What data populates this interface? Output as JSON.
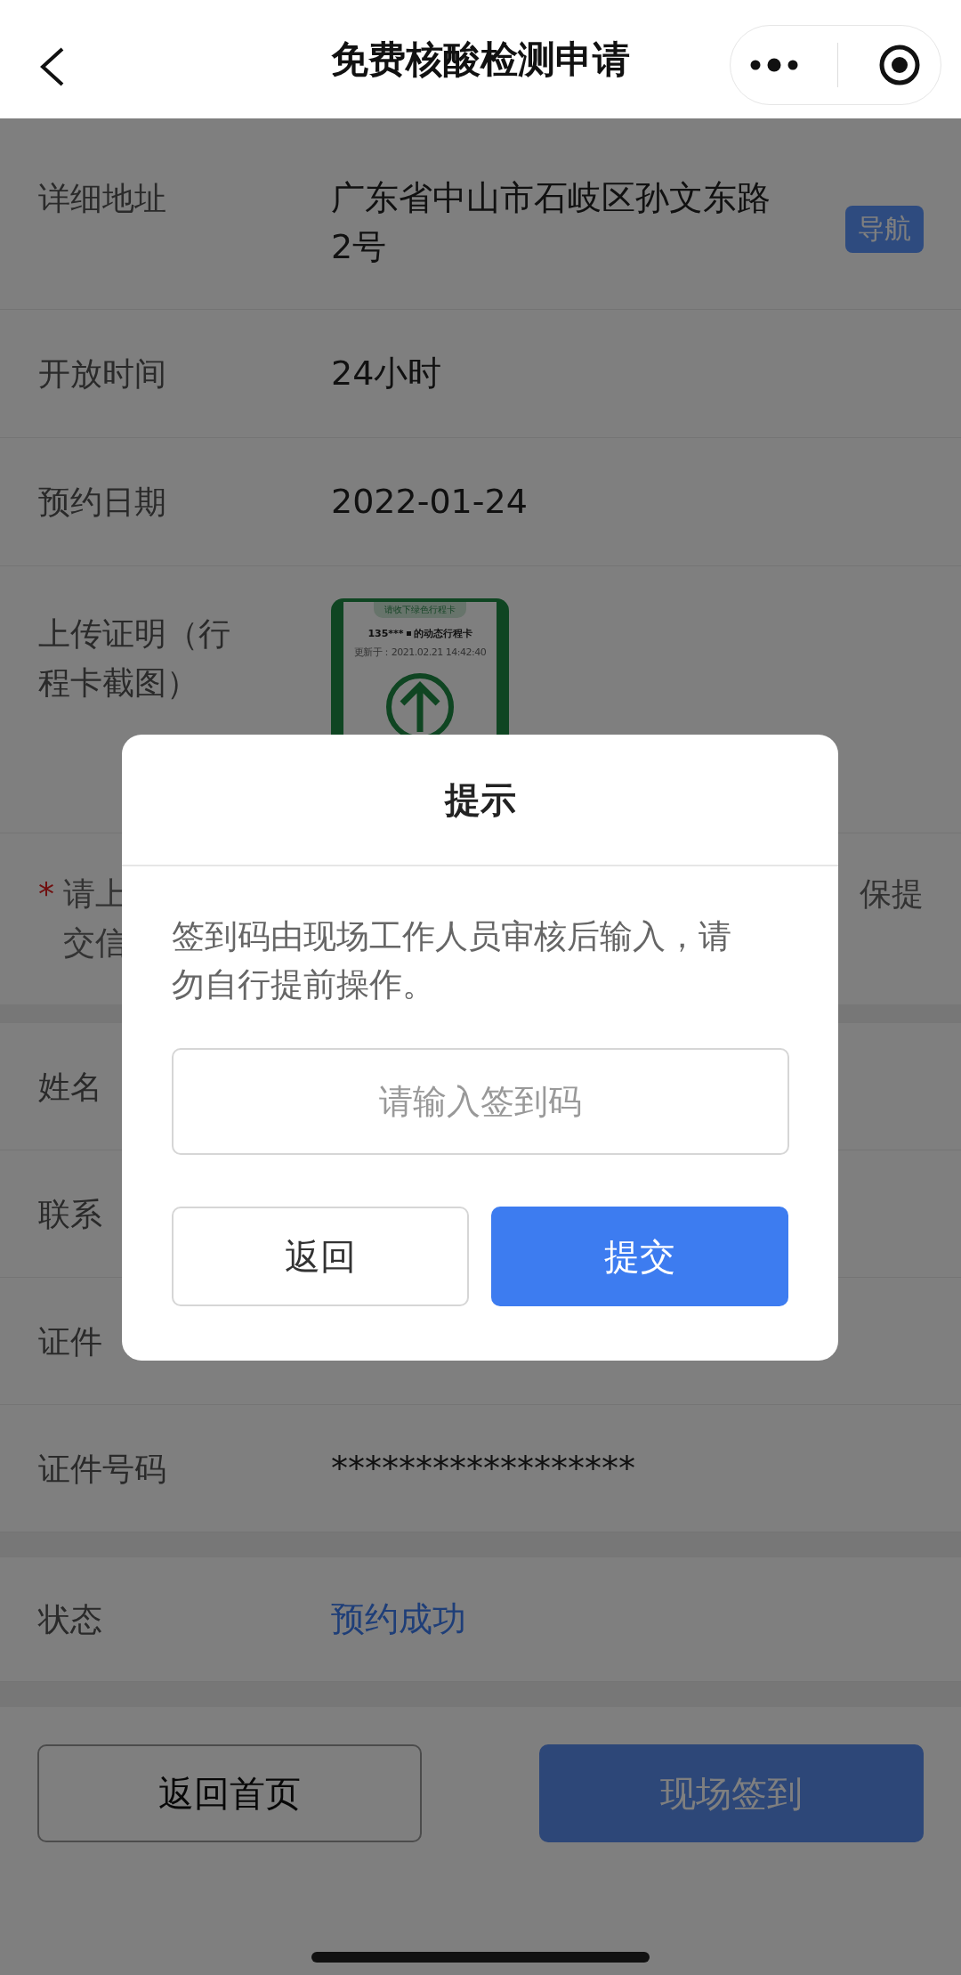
{
  "header": {
    "title": "免费核酸检测申请"
  },
  "details": [
    {
      "label": "详细地址",
      "value": "广东省中山市石岐区孙文东路2号",
      "action": "导航"
    },
    {
      "label": "开放时间",
      "value": "24小时"
    },
    {
      "label": "预约日期",
      "value": "2022-01-24"
    }
  ],
  "upload": {
    "label": "上传证明（行程卡截图）",
    "screenshot": {
      "banner": "请收下绿色行程卡",
      "phone": "135***",
      "heading": "的动态行程卡",
      "updated": "更新于：2021.02.21 14:42:40"
    }
  },
  "note": {
    "mark": "*",
    "left_lines": [
      "请上",
      "交信"
    ],
    "right": "保提"
  },
  "person": [
    {
      "label": "姓名"
    },
    {
      "label": "联系"
    },
    {
      "label": "证件"
    },
    {
      "label": "证件号码",
      "value": "******************"
    }
  ],
  "status": {
    "label": "状态",
    "value": "预约成功"
  },
  "buttons": [
    {
      "label": "返回首页",
      "kind": "secondary"
    },
    {
      "label": "现场签到",
      "kind": "primary"
    }
  ],
  "dialog": {
    "title": "提示",
    "message": "签到码由现场工作人员审核后输入，请勿自行提前操作。",
    "input": {
      "placeholder": "请输入签到码"
    },
    "buttons": [
      {
        "label": "返回",
        "kind": "secondary"
      },
      {
        "label": "提交",
        "kind": "primary"
      }
    ]
  }
}
